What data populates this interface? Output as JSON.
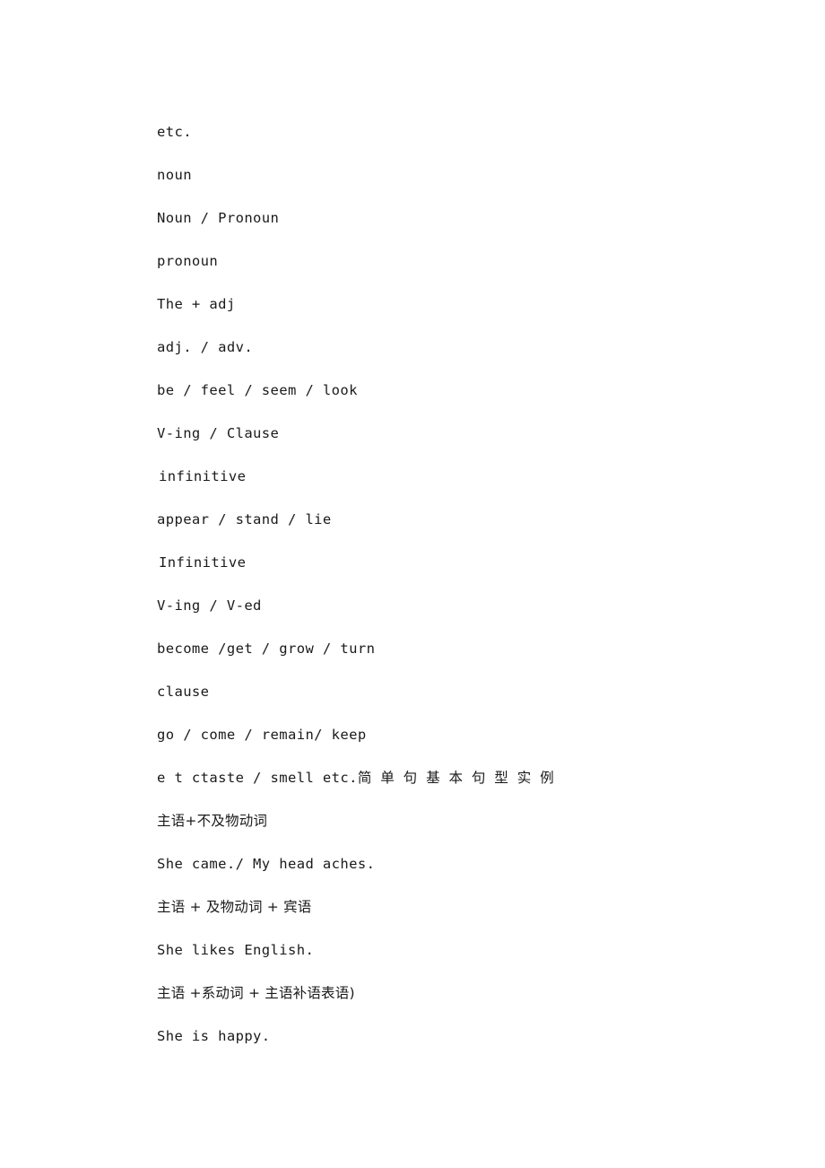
{
  "document": {
    "page_background": "#ffffff",
    "text_color": "#1a1a1a",
    "lines": [
      {
        "id": "l1",
        "text": "etc.",
        "style": "latin"
      },
      {
        "id": "l2",
        "text": "noun",
        "style": "latin"
      },
      {
        "id": "l3",
        "text": "Noun / Pronoun",
        "style": "latin"
      },
      {
        "id": "l4",
        "text": "pronoun",
        "style": "latin"
      },
      {
        "id": "l5",
        "text": "The + adj",
        "style": "latin"
      },
      {
        "id": "l6",
        "text": "adj. / adv.",
        "style": "latin"
      },
      {
        "id": "l7",
        "text": "be / feel / seem / look",
        "style": "latin"
      },
      {
        "id": "l8",
        "text": "V-ing / Clause",
        "style": "latin"
      },
      {
        "id": "l9",
        "text": "infinitive",
        "style": "latin-indent"
      },
      {
        "id": "l10",
        "text": "appear / stand / lie",
        "style": "latin"
      },
      {
        "id": "l11",
        "text": "Infinitive",
        "style": "latin-indent"
      },
      {
        "id": "l12",
        "text": "V-ing / V-ed",
        "style": "latin"
      },
      {
        "id": "l13",
        "text": "become /get / grow / turn",
        "style": "latin"
      },
      {
        "id": "l14",
        "text": "clause",
        "style": "latin"
      },
      {
        "id": "l15",
        "text": "go / come / remain/ keep",
        "style": "latin"
      },
      {
        "id": "l16",
        "text": "e t ctaste / smell  etc. 简单句基本句型实例",
        "style": "justified-mixed"
      },
      {
        "id": "l17",
        "text": "主语+不及物动词",
        "style": "cjk"
      },
      {
        "id": "l18",
        "text": "She came./ My head aches.",
        "style": "latin"
      },
      {
        "id": "l19",
        "text": "主语 + 及物动词 + 宾语",
        "style": "cjk"
      },
      {
        "id": "l20",
        "text": "She likes English.",
        "style": "latin"
      },
      {
        "id": "l21",
        "text": "主语 +系动词 + 主语补语表语)",
        "style": "cjk"
      },
      {
        "id": "l22",
        "text": "She is happy.",
        "style": "latin"
      }
    ],
    "line16_parts": {
      "latin": "e t ctaste / smell  etc.",
      "cjk": "简单句基本句型实例"
    }
  }
}
